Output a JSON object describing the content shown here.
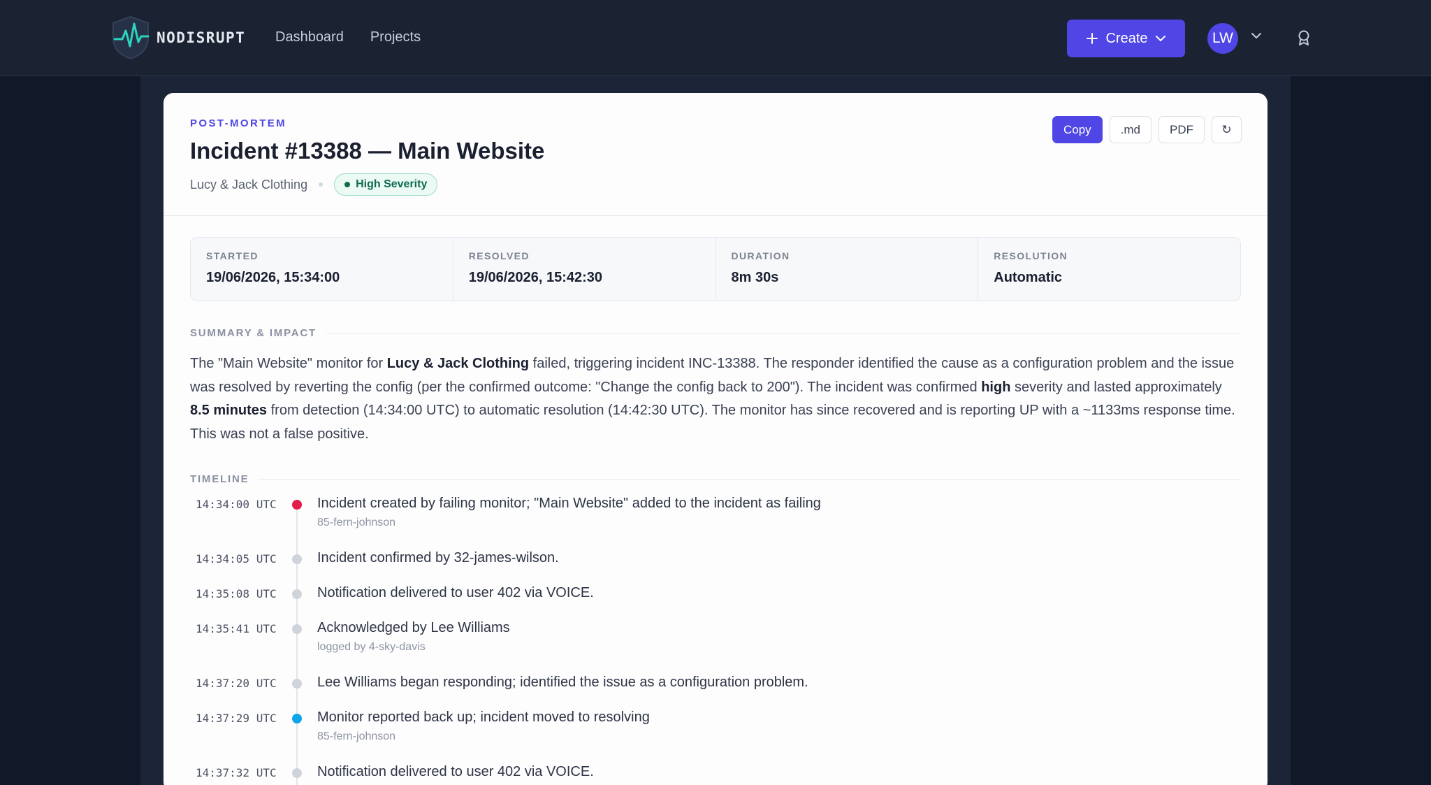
{
  "nav": {
    "brand": "NODISRUPT",
    "links": [
      "Dashboard",
      "Projects"
    ],
    "create_label": "Create",
    "avatar_initials": "LW"
  },
  "header": {
    "eyebrow": "POST-MORTEM",
    "title": "Incident #13388 — Main Website",
    "org": "Lucy & Jack Clothing",
    "severity": "High Severity",
    "actions": {
      "copy": "Copy",
      "md": ".md",
      "pdf": "PDF",
      "refresh": "↻"
    }
  },
  "stats": [
    {
      "label": "STARTED",
      "value": "19/06/2026, 15:34:00"
    },
    {
      "label": "RESOLVED",
      "value": "19/06/2026, 15:42:30"
    },
    {
      "label": "DURATION",
      "value": "8m 30s"
    },
    {
      "label": "RESOLUTION",
      "value": "Automatic"
    }
  ],
  "summary": {
    "heading": "SUMMARY & IMPACT",
    "p1": "The \"Main Website\" monitor for ",
    "org": "Lucy & Jack Clothing",
    "p2": " failed, triggering incident INC-13388. The responder identified the cause as a configuration problem and the issue was resolved by reverting the config (per the confirmed outcome: \"Change the config back to 200\"). The incident was confirmed ",
    "severity": "high",
    "p3": " severity and lasted approximately ",
    "duration": "8.5 minutes",
    "p4": " from detection (14:34:00 UTC) to automatic resolution (14:42:30 UTC). The monitor has since recovered and is reporting UP with a ~1133ms response time. This was not a false positive."
  },
  "timeline": {
    "heading": "TIMELINE",
    "events": [
      {
        "time": "14:34:00 UTC",
        "text": "Incident created by failing monitor; \"Main Website\" added to the incident as failing",
        "sub": "85-fern-johnson"
      },
      {
        "time": "14:34:05 UTC",
        "text": "Incident confirmed by 32-james-wilson.",
        "sub": ""
      },
      {
        "time": "14:35:08 UTC",
        "text": "Notification delivered to user 402 via VOICE.",
        "sub": ""
      },
      {
        "time": "14:35:41 UTC",
        "text": "Acknowledged by Lee Williams",
        "sub": "logged by 4-sky-davis"
      },
      {
        "time": "14:37:20 UTC",
        "text": "Lee Williams began responding; identified the issue as a configuration problem.",
        "sub": ""
      },
      {
        "time": "14:37:29 UTC",
        "text": "Monitor reported back up; incident moved to resolving",
        "sub": "85-fern-johnson"
      },
      {
        "time": "14:37:32 UTC",
        "text": "Notification delivered to user 402 via VOICE.",
        "sub": ""
      }
    ]
  },
  "colors": {
    "accent": "#4f46e5",
    "severity": "#0f6a4f",
    "timeline_created": "#e11d48",
    "timeline_recovered": "#0ea5e9"
  }
}
